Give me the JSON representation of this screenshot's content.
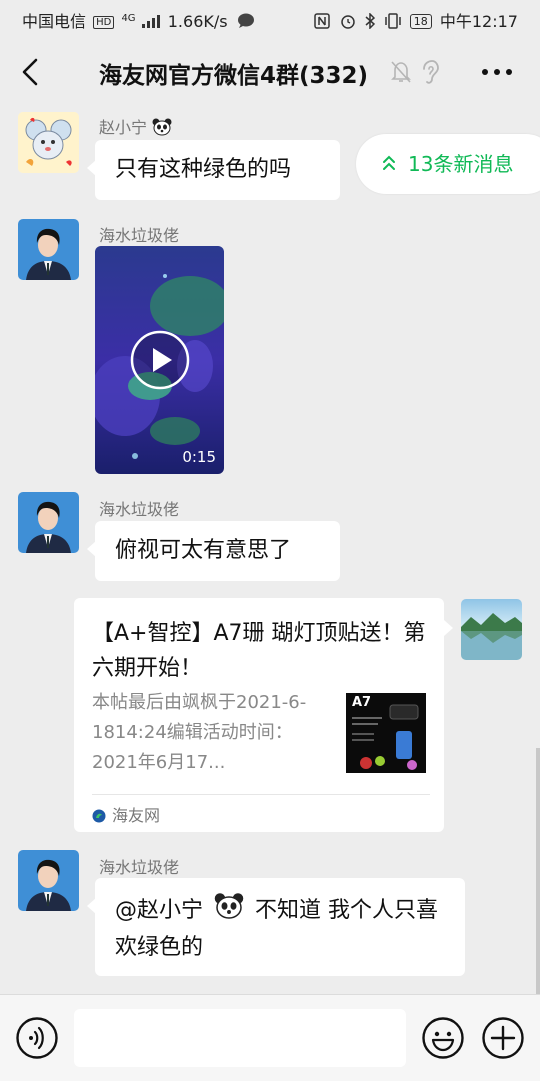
{
  "status": {
    "carrier": "中国电信",
    "network": "HD",
    "net_type": "4G",
    "speed": "1.66K/s",
    "battery": "18",
    "time": "中午12:17"
  },
  "header": {
    "title": "海友网官方微信4群(332)"
  },
  "new_messages": {
    "label": "13条新消息"
  },
  "messages": [
    {
      "sender": "赵小宁",
      "text": "只有这种绿色的吗"
    },
    {
      "sender": "海水垃圾佬",
      "video_duration": "0:15"
    },
    {
      "sender": "海水垃圾佬",
      "text": "俯视可太有意思了"
    },
    {
      "card_title": "【A+智控】A7珊 瑚灯顶贴送！第六期开始！",
      "card_desc": "本帖最后由飒枫于2021-6-1814:24编辑活动时间：2021年6月17...",
      "card_thumb_label": "A7",
      "card_source": "海友网"
    },
    {
      "sender": "海水垃圾佬",
      "mention": "@赵小宁",
      "text_after": "不知道 我个人只喜欢绿色的"
    }
  ],
  "colors": {
    "background": "#ededed",
    "bubble": "#ffffff",
    "accent_green": "#10b956"
  },
  "icons": {
    "back": "chevron-left-icon",
    "mute": "bell-off-icon",
    "earpiece": "ear-icon",
    "more": "more-dots-icon",
    "voice": "voice-icon",
    "emoji": "emoji-icon",
    "plus": "plus-icon"
  }
}
